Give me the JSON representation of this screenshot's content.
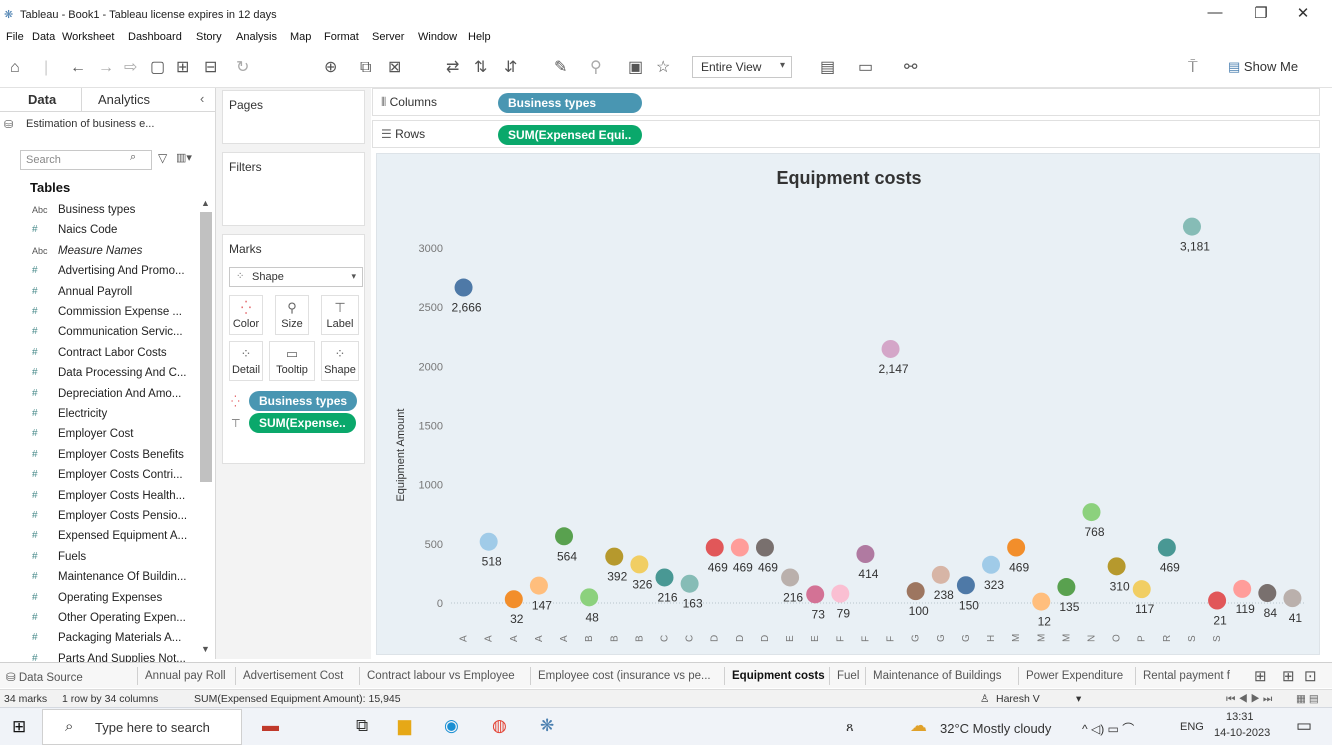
{
  "window": {
    "title": "Tableau - Book1 - Tableau license expires in 12 days",
    "minimize": "—",
    "restore": "❐",
    "close": "✕"
  },
  "menu": [
    "File",
    "Data",
    "Worksheet",
    "Dashboard",
    "Story",
    "Analysis",
    "Map",
    "Format",
    "Server",
    "Window",
    "Help"
  ],
  "toolbar": {
    "fit_value": "Entire View",
    "show_me": "Show Me"
  },
  "left_pane": {
    "tab_data": "Data",
    "tab_analytics": "Analytics",
    "data_source": "Estimation of business e...",
    "search_placeholder": "Search",
    "tables_header": "Tables",
    "fields": [
      {
        "type": "Abc",
        "name": "Business types",
        "italic": false
      },
      {
        "type": "#",
        "name": "Naics Code",
        "italic": false
      },
      {
        "type": "Abc",
        "name": "Measure Names",
        "italic": true
      },
      {
        "type": "#",
        "name": "Advertising And Promo...",
        "italic": false
      },
      {
        "type": "#",
        "name": "Annual Payroll",
        "italic": false
      },
      {
        "type": "#",
        "name": "Commission Expense ...",
        "italic": false
      },
      {
        "type": "#",
        "name": "Communication Servic...",
        "italic": false
      },
      {
        "type": "#",
        "name": "Contract Labor Costs",
        "italic": false
      },
      {
        "type": "#",
        "name": "Data Processing And C...",
        "italic": false
      },
      {
        "type": "#",
        "name": "Depreciation And Amo...",
        "italic": false
      },
      {
        "type": "#",
        "name": "Electricity",
        "italic": false
      },
      {
        "type": "#",
        "name": "Employer Cost",
        "italic": false
      },
      {
        "type": "#",
        "name": "Employer Costs Benefits",
        "italic": false
      },
      {
        "type": "#",
        "name": "Employer Costs Contri...",
        "italic": false
      },
      {
        "type": "#",
        "name": "Employer Costs Health...",
        "italic": false
      },
      {
        "type": "#",
        "name": "Employer Costs Pensio...",
        "italic": false
      },
      {
        "type": "#",
        "name": "Expensed Equipment A...",
        "italic": false
      },
      {
        "type": "#",
        "name": "Fuels",
        "italic": false
      },
      {
        "type": "#",
        "name": "Maintenance Of Buildin...",
        "italic": false
      },
      {
        "type": "#",
        "name": "Operating Expenses",
        "italic": false
      },
      {
        "type": "#",
        "name": "Other Operating Expen...",
        "italic": false
      },
      {
        "type": "#",
        "name": "Packaging Materials A...",
        "italic": false
      },
      {
        "type": "#",
        "name": "Parts And Supplies Not...",
        "italic": false
      }
    ]
  },
  "cards": {
    "pages": "Pages",
    "filters": "Filters",
    "marks": "Marks",
    "mark_type": "Shape",
    "mark_buttons": [
      "Color",
      "Size",
      "Label",
      "Detail",
      "Tooltip",
      "Shape"
    ],
    "mark_pills": [
      "Business types",
      "SUM(Expense.."
    ]
  },
  "shelves": {
    "columns_label": "Columns",
    "columns_pill": "Business types",
    "rows_label": "Rows",
    "rows_pill": "SUM(Expensed Equi.."
  },
  "chart_data": {
    "type": "scatter",
    "title": "Equipment costs",
    "ylabel": "Equipment Amount",
    "ylim": [
      -300,
      3300
    ],
    "yticks": [
      0,
      500,
      1000,
      1500,
      2000,
      2500,
      3000
    ],
    "categories": [
      "A",
      "A",
      "A",
      "A",
      "A",
      "B",
      "B",
      "B",
      "C",
      "C",
      "D",
      "D",
      "D",
      "E",
      "E",
      "F",
      "F",
      "F",
      "G",
      "G",
      "G",
      "H",
      "M",
      "M",
      "M",
      "N",
      "O",
      "P",
      "R",
      "S",
      "S",
      "",
      ""
    ],
    "values": [
      2666,
      518,
      32,
      147,
      564,
      48,
      392,
      326,
      216,
      163,
      469,
      469,
      469,
      216,
      73,
      79,
      414,
      2147,
      100,
      238,
      150,
      323,
      469,
      12,
      135,
      768,
      310,
      117,
      469,
      3181,
      21,
      119,
      84,
      41
    ],
    "labels": [
      "2,666",
      "518",
      "32",
      "147",
      "564",
      "48",
      "392",
      "326",
      "216",
      "163",
      "469",
      "469",
      "469",
      "216",
      "73",
      "79",
      "414",
      "2,147",
      "100",
      "238",
      "150",
      "323",
      "469",
      "12",
      "135",
      "768",
      "310",
      "117",
      "469",
      "3,181",
      "21",
      "119",
      "84",
      "41"
    ],
    "colors": [
      "#4e79a7",
      "#a0cbe8",
      "#f28e2b",
      "#ffbe7d",
      "#59a14f",
      "#8cd17d",
      "#b6992d",
      "#f1ce63",
      "#499894",
      "#86bcb6",
      "#e15759",
      "#ff9d9a",
      "#79706e",
      "#bab0ac",
      "#d37295",
      "#fabfd2",
      "#b07aa1",
      "#d4a6c8",
      "#9d7660",
      "#d7b5a6",
      "#4e79a7",
      "#a0cbe8",
      "#f28e2b",
      "#ffbe7d",
      "#59a14f",
      "#8cd17d",
      "#b6992d",
      "#f1ce63",
      "#499894",
      "#86bcb6",
      "#e15759",
      "#ff9d9a",
      "#79706e",
      "#bab0ac"
    ]
  },
  "sheets": [
    "Data Source",
    "Annual pay Roll",
    "Advertisement Cost",
    "Contract labour vs Employee",
    "Employee cost (insurance vs pe...",
    "Equipment costs",
    "Fuel",
    "Maintenance of Buildings",
    "Power Expenditure",
    "Rental payment f"
  ],
  "active_sheet": "Equipment costs",
  "status": {
    "marks": "34 marks",
    "dims": "1 row by 34 columns",
    "sum": "SUM(Expensed Equipment Amount): 15,945",
    "user": "Haresh V"
  },
  "taskbar": {
    "search": "Type here to search",
    "weather": "32°C  Mostly cloudy",
    "lang": "ENG",
    "time": "13:31",
    "date": "14-10-2023"
  }
}
